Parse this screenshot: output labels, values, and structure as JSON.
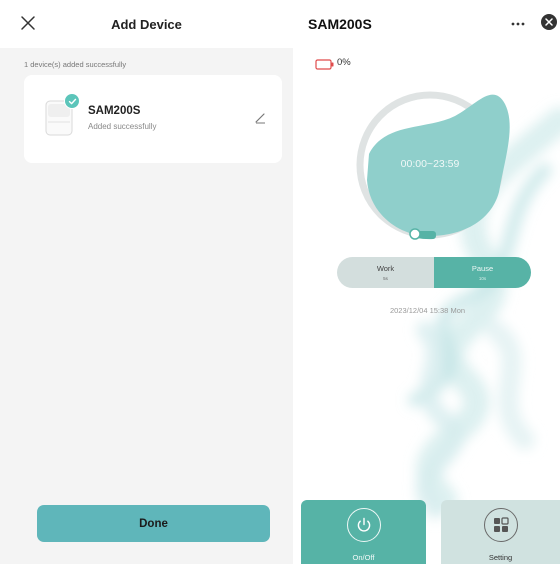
{
  "add_device": {
    "title": "Add Device",
    "status": "1 device(s) added successfully",
    "device": {
      "name": "SAM200S",
      "status": "Added successfully"
    },
    "done_label": "Done"
  },
  "device_panel": {
    "title": "SAM200S",
    "battery": {
      "percent_label": "0%",
      "level": 0,
      "color": "#e04b4b"
    },
    "schedule": {
      "time_range": "00:00~23:59"
    },
    "mode": {
      "work": {
        "label": "Work",
        "sub": "5s"
      },
      "pause": {
        "label": "Pause",
        "sub": "10s"
      },
      "selected": "pause"
    },
    "datetime": "2023/12/04 15:38 Mon",
    "buttons": {
      "onoff_label": "On/Off",
      "setting_label": "Setting"
    }
  },
  "colors": {
    "accent": "#5cc5ba",
    "teal": "#56b3a6",
    "done": "#5fb6ba"
  }
}
